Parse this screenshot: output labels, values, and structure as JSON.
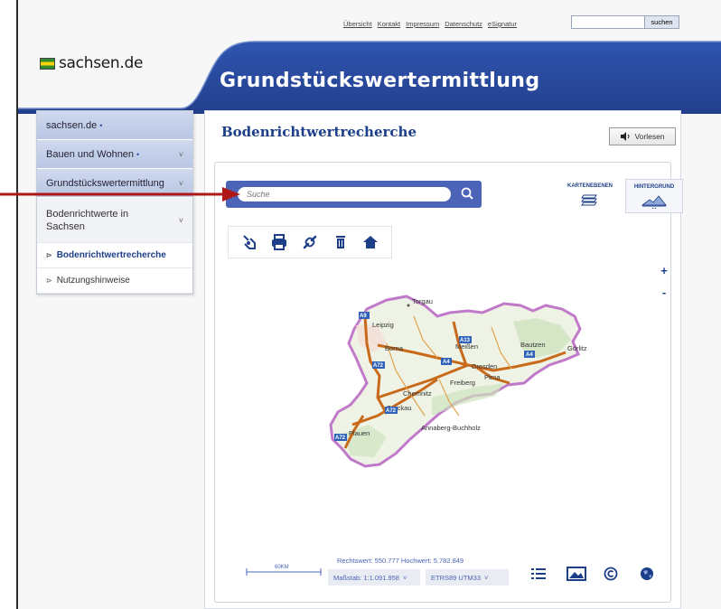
{
  "topnav": {
    "links": [
      "Übersicht",
      "Kontakt",
      "Impressum",
      "Datenschutz",
      "eSignatur"
    ],
    "search_placeholder": "",
    "search_button": "suchen"
  },
  "header": {
    "logo_text": "sachsen.de",
    "title": "Grundstückswertermittlung"
  },
  "sidebar": {
    "items": [
      {
        "label": "sachsen.de",
        "dot": "•"
      },
      {
        "label": "Bauen und Wohnen",
        "dot": "•",
        "chevron": "˅"
      },
      {
        "label": "Grundstückswertermittlung",
        "chevron": "˅"
      },
      {
        "label": "Bodenrichtwerte in Sachsen",
        "chevron": "˅"
      },
      {
        "label": "Bodenrichtwertrecherche",
        "bullet": "⊳"
      },
      {
        "label": "Nutzungshinweise",
        "bullet": "⊳"
      }
    ]
  },
  "main": {
    "title": "Bodenrichtwertrecherche",
    "vorlesen": "Vorlesen",
    "search_placeholder": "Suche",
    "layers": {
      "karten": "KARTENEBENEN",
      "hintergrund": "HINTERGRUND"
    },
    "zoom_in": "+",
    "zoom_out": "-",
    "scale_label": "60KM",
    "coords": "Rechtswert: 550.777 Hochwert: 5.782.849",
    "massstab": "Maßstab: 1:1.091.958",
    "crs": "ETRS89 UTM33",
    "select_caret": "˅",
    "map_labels": {
      "torgau": "Torgau",
      "leipzig": "Leipzig",
      "borna": "Borna",
      "meissen": "Meißen",
      "bautzen": "Bautzen",
      "goerlitz": "Görlitz",
      "dresden": "Dresden",
      "pirna": "Pirna",
      "freiberg": "Freiberg",
      "chemnitz": "Chemnitz",
      "zwickau": "Zwickau",
      "annaberg": "Annaberg-Buchholz",
      "plauen": "Plauen",
      "a9": "A9",
      "a13": "A13",
      "a72a": "A72",
      "a72b": "A72",
      "a72c": "A72",
      "a4a": "A4",
      "a4b": "A4"
    }
  },
  "colors": {
    "brand_blue": "#1d3f8a",
    "banner_blue": "#2a4ea6",
    "searchbar": "#4b64b8",
    "arrow": "#b01818"
  }
}
